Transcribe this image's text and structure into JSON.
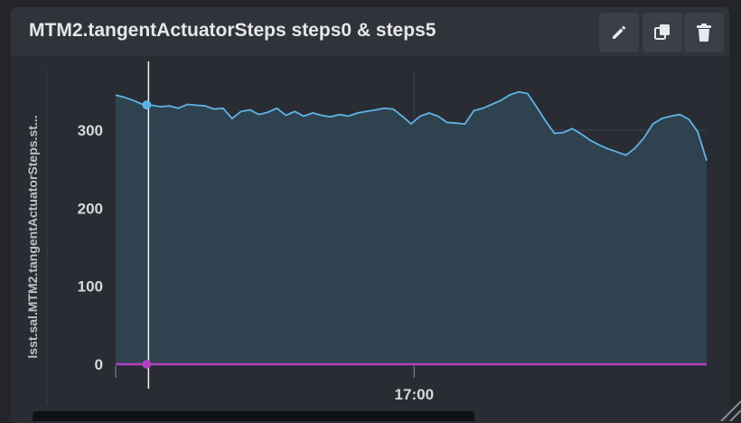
{
  "panel": {
    "title": "MTM2.tangentActuatorSteps steps0 & steps5",
    "toolbar": {
      "edit_icon": "pencil-icon",
      "duplicate_icon": "copy-icon",
      "delete_icon": "trash-icon"
    }
  },
  "colors": {
    "background": "#2a2c33",
    "series0": "#5fb3e3",
    "series0_fill": "#2f4352",
    "series5": "#b03fbf",
    "grid": "#3d4452",
    "cursor": "#f2f2f2"
  },
  "chart_data": {
    "type": "area",
    "title": "MTM2.tangentActuatorSteps steps0 & steps5",
    "ylabel": "lsst.sal.MTM2.tangentActuatorSteps.st...",
    "xlabel": "",
    "ylim": [
      -10,
      370
    ],
    "yticks": [
      0,
      100,
      200,
      300
    ],
    "xticks": [
      {
        "x": 100,
        "label": "17:00"
      }
    ],
    "x": [
      0,
      3,
      6,
      9,
      12,
      15,
      18,
      21,
      24,
      27,
      30,
      33,
      36,
      39,
      42,
      45,
      48,
      51,
      54,
      57,
      60,
      63,
      66,
      69,
      72,
      75,
      78,
      81,
      84,
      87,
      90,
      93,
      96,
      99,
      102,
      105,
      108,
      111,
      114,
      117,
      120,
      123,
      126,
      129,
      132,
      135,
      138,
      141,
      144,
      147,
      150,
      153,
      156,
      159,
      162,
      165,
      168,
      171,
      174,
      177,
      180,
      183,
      186,
      189,
      192,
      195,
      198
    ],
    "grid": true,
    "legend": "none",
    "cursor_x": 11,
    "series": [
      {
        "values": [
          345,
          342,
          338,
          333,
          332,
          330,
          331,
          328,
          333,
          332,
          331,
          327,
          328,
          315,
          324,
          326,
          320,
          323,
          328,
          319,
          324,
          318,
          322,
          319,
          317,
          320,
          318,
          322,
          324,
          326,
          328,
          327,
          318,
          308,
          318,
          322,
          318,
          310,
          309,
          308,
          325,
          328,
          333,
          338,
          345,
          349,
          347,
          330,
          312,
          296,
          297,
          302,
          295,
          287,
          281,
          276,
          272,
          268,
          277,
          290,
          308,
          315,
          318,
          320,
          314,
          298,
          261
        ],
        "color": "#5fb3e3"
      },
      {
        "values": [
          0,
          0,
          0,
          0,
          0,
          0,
          0,
          0,
          0,
          0,
          0,
          0,
          0,
          0,
          0,
          0,
          0,
          0,
          0,
          0,
          0,
          0,
          0,
          0,
          0,
          0,
          0,
          0,
          0,
          0,
          0,
          0,
          0,
          0,
          0,
          0,
          0,
          0,
          0,
          0,
          0,
          0,
          0,
          0,
          0,
          0,
          0,
          0,
          0,
          0,
          0,
          0,
          0,
          0,
          0,
          0,
          0,
          0,
          0,
          0,
          0,
          0,
          0,
          0,
          0,
          0,
          0
        ],
        "color": "#b03fbf"
      }
    ]
  }
}
